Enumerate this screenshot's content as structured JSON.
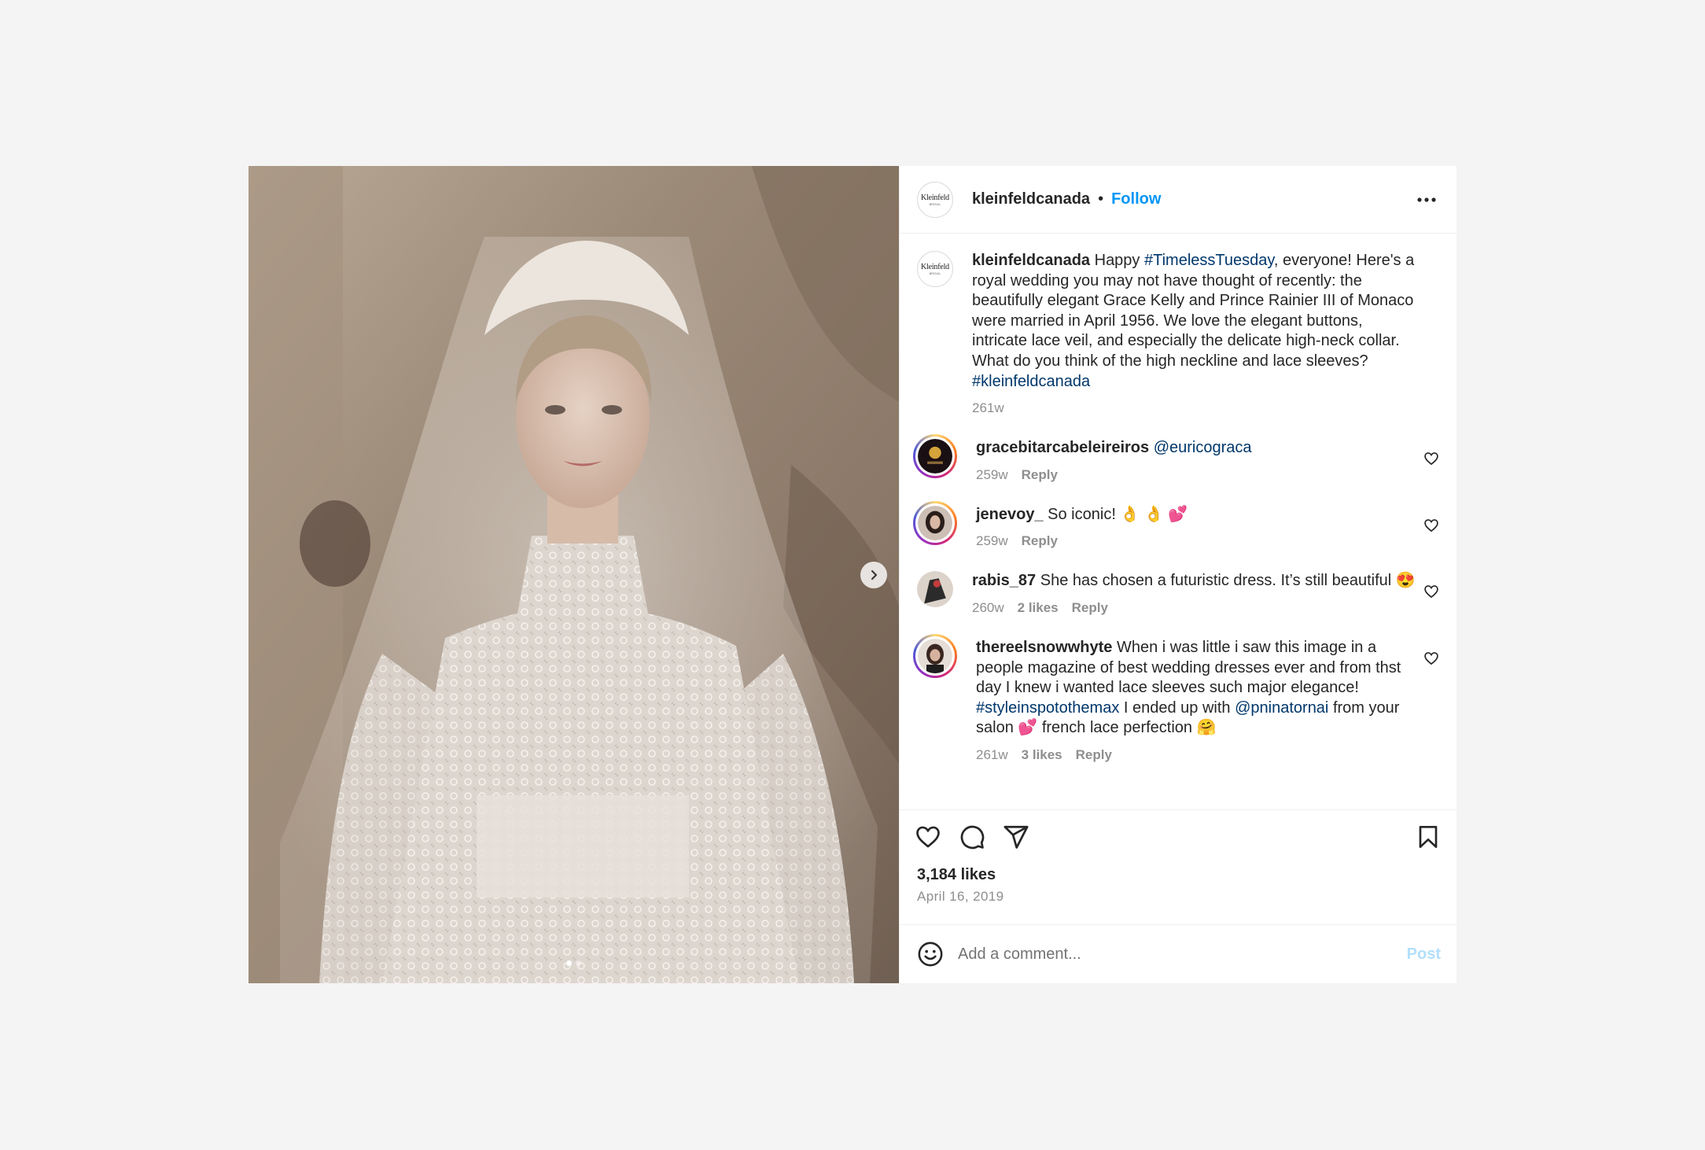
{
  "post": {
    "author": "kleinfeldcanada",
    "follow_label": "Follow",
    "separator": "•",
    "avatar_logo": "Kleinfeld",
    "avatar_logo_sub": "BRIDAL",
    "media": {
      "slide_index": 1,
      "slide_count": 2,
      "next_icon": "chevron-right-icon"
    },
    "more_icon": "more-horizontal-icon"
  },
  "caption": {
    "username": "kleinfeldcanada",
    "text_1": " Happy ",
    "hashtag_1": "#TimelessTuesday",
    "text_2": ", everyone! Here's a royal wedding you may not have thought of recently: the beautifully elegant Grace Kelly and Prince Rainier III of Monaco were married in April 1956. We love the elegant buttons, intricate lace veil, and especially the delicate high-neck collar. What do you think of the high neckline and lace sleeves? ",
    "hashtag_2": "#kleinfeldcanada",
    "time": "261w"
  },
  "comments": [
    {
      "username": "gracebitarcabeleireiros",
      "text": " ",
      "mention": "@euricograca",
      "time": "259w",
      "reply": "Reply",
      "avatar_ring": true
    },
    {
      "username": "jenevoy_",
      "text": " So iconic! 👌 👌 💕",
      "time": "259w",
      "reply": "Reply",
      "avatar_ring": true
    },
    {
      "username": "rabis_87",
      "text": " She has chosen a futuristic dress. It’s still beautiful 😍",
      "time": "260w",
      "likes": "2 likes",
      "reply": "Reply",
      "avatar_ring": false
    },
    {
      "username": "thereelsnowwhyte",
      "text_1": " When i was little i saw this image in a people magazine of best wedding dresses ever and from thst day I knew i wanted lace sleeves such major elegance! ",
      "hashtag": "#styleinspotothemax",
      "text_2": " I ended up with ",
      "mention": "@pninatornai",
      "text_3": " from your salon 💕 french lace perfection 🤗",
      "time": "261w",
      "likes": "3 likes",
      "reply": "Reply",
      "avatar_ring": true
    }
  ],
  "actions": {
    "icons": [
      "heart-icon",
      "comment-icon",
      "share-icon",
      "bookmark-icon"
    ],
    "likes": "3,184 likes",
    "date": "April 16, 2019"
  },
  "add_comment": {
    "placeholder": "Add a comment...",
    "post_label": "Post",
    "emoji_icon": "emoji-icon"
  },
  "colors": {
    "link": "#0095f6",
    "hashtag": "#00376b",
    "muted": "#8e8e8e",
    "post_disabled": "#b2dffc"
  }
}
